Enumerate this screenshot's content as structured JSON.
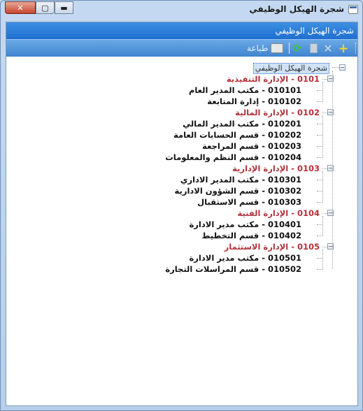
{
  "window": {
    "title": "شجرة الهيكل الوظيفي",
    "caption_buttons": {
      "close": "✕",
      "maximize": "▢",
      "minimize": "▬"
    }
  },
  "panel": {
    "header": "شجرة الهيكل الوظيفي"
  },
  "toolbar": {
    "add_icon": "plus-icon",
    "delete_icon": "delete-x-icon",
    "copy_icon": "copy-icon",
    "refresh_icon": "refresh-icon",
    "print_label": "طباعة",
    "add_glyph": "+",
    "delete_glyph": "✕",
    "refresh_glyph": "⟳"
  },
  "tree": {
    "root": "شجرة الهيكل الوظيفي",
    "departments": [
      {
        "label": "0101 - الإدارة التنفيذية",
        "units": [
          "010101 - مكتب المدير العام",
          "010102 - إدارة المتابعة"
        ]
      },
      {
        "label": "0102 - الإدارة المالية",
        "units": [
          "010201 - مكتب المدير المالي",
          "010202 - قسم الحسابات العامة",
          "010203 - قسم المراجعة",
          "010204 - قسم النظم والمعلومات"
        ]
      },
      {
        "label": "0103 - الإدارة الإدارية",
        "units": [
          "010301 - مكتب المدير الاداري",
          "010302 - قسم الشؤون الادارية",
          "010303 - قسم الاستقبال"
        ]
      },
      {
        "label": "0104 - الإدارة الفنية",
        "units": [
          "010401 - مكتب مدير الادارة",
          "010402 - قسم التخطيط"
        ]
      },
      {
        "label": "0105 - الإدارة الاستثمار",
        "units": [
          "010501 - مكتب مدير الادارة",
          "010502 - قسم المراسلات التجارة"
        ]
      }
    ]
  },
  "colors": {
    "header_bg": "#2f7fdc",
    "department_text": "#b3313b",
    "unit_text": "#111111",
    "selection_bg": "#cfe2f7"
  }
}
